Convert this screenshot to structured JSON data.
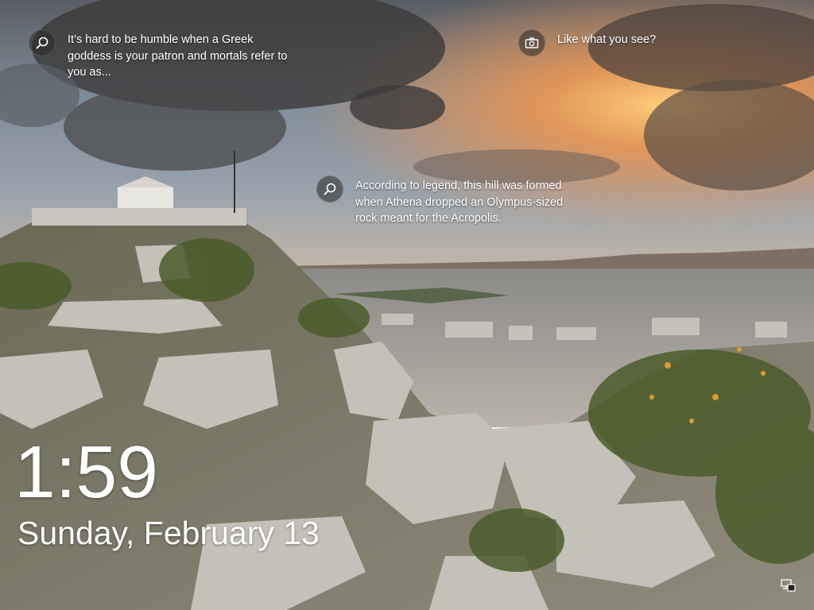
{
  "spotlight": {
    "hotspot_top_left": {
      "icon": "magnifier-icon",
      "text": "It’s hard to be humble when a Greek goddess is your patron and mortals refer to you as..."
    },
    "hotspot_top_right": {
      "icon": "camera-icon",
      "text": "Like what you see?"
    },
    "hotspot_middle": {
      "icon": "magnifier-icon",
      "text": "According to legend, this hill was formed when Athena dropped an Olympus-sized rock meant for the Acropolis."
    }
  },
  "clock": {
    "time": "1:59",
    "date": "Sunday, February 13"
  },
  "tray": {
    "network_icon": "network-ethernet-icon"
  },
  "colors": {
    "sky_top": "#6f7e8e",
    "sunset": "#f2a05a",
    "rock": "#bdbab2",
    "foliage": "#4d5a2c"
  }
}
